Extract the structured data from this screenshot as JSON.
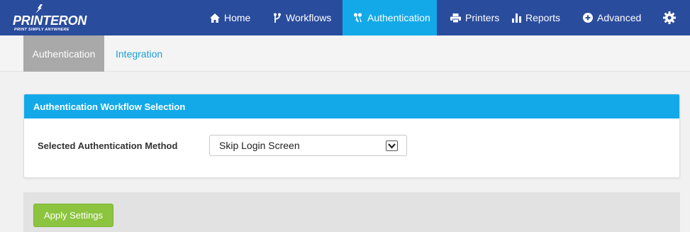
{
  "brand": {
    "logo_text": "PRINTERON",
    "tagline": "PRINT SIMPLY ANYWHERE"
  },
  "topnav": {
    "items": [
      {
        "label": "Home",
        "icon": "home-icon"
      },
      {
        "label": "Workflows",
        "icon": "workflow-icon"
      },
      {
        "label": "Authentication",
        "icon": "authentication-icon",
        "active": true
      },
      {
        "label": "Printers",
        "icon": "printer-icon"
      },
      {
        "label": "Reports",
        "icon": "bar-chart-icon"
      },
      {
        "label": "Advanced",
        "icon": "plus-circle-icon"
      }
    ],
    "settings_icon": "gear-icon"
  },
  "subnav": {
    "tabs": [
      {
        "label": "Authentication",
        "active": true
      },
      {
        "label": "Integration",
        "active": false
      }
    ]
  },
  "panel": {
    "title": "Authentication Workflow Selection",
    "field_label": "Selected Authentication Method",
    "selected_value": "Skip Login Screen"
  },
  "footer": {
    "apply_label": "Apply Settings"
  },
  "colors": {
    "nav_bg": "#2a4c9d",
    "accent": "#13a9e9",
    "apply_green": "#8cc43f",
    "link": "#1a9fd8"
  }
}
